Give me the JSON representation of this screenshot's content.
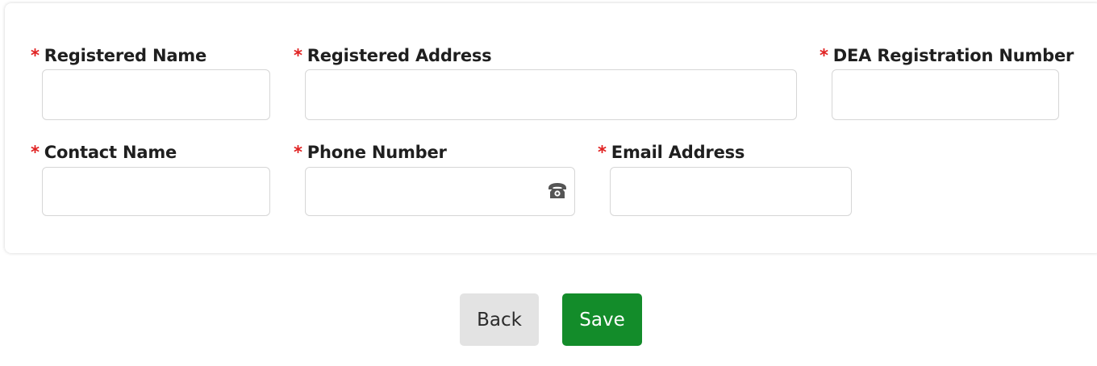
{
  "form": {
    "required_marker": "*",
    "fields": {
      "registered_name": {
        "label": "Registered Name",
        "value": ""
      },
      "registered_address": {
        "label": "Registered Address",
        "value": ""
      },
      "dea_number": {
        "label": "DEA Registration Number",
        "value": ""
      },
      "contact_name": {
        "label": "Contact Name",
        "value": ""
      },
      "phone_number": {
        "label": "Phone Number",
        "value": "",
        "icon": "phone-icon"
      },
      "email_address": {
        "label": "Email Address",
        "value": ""
      }
    }
  },
  "actions": {
    "back_label": "Back",
    "save_label": "Save"
  },
  "colors": {
    "required": "#e02020",
    "save_button": "#138c2a",
    "back_button": "#e3e3e3"
  }
}
